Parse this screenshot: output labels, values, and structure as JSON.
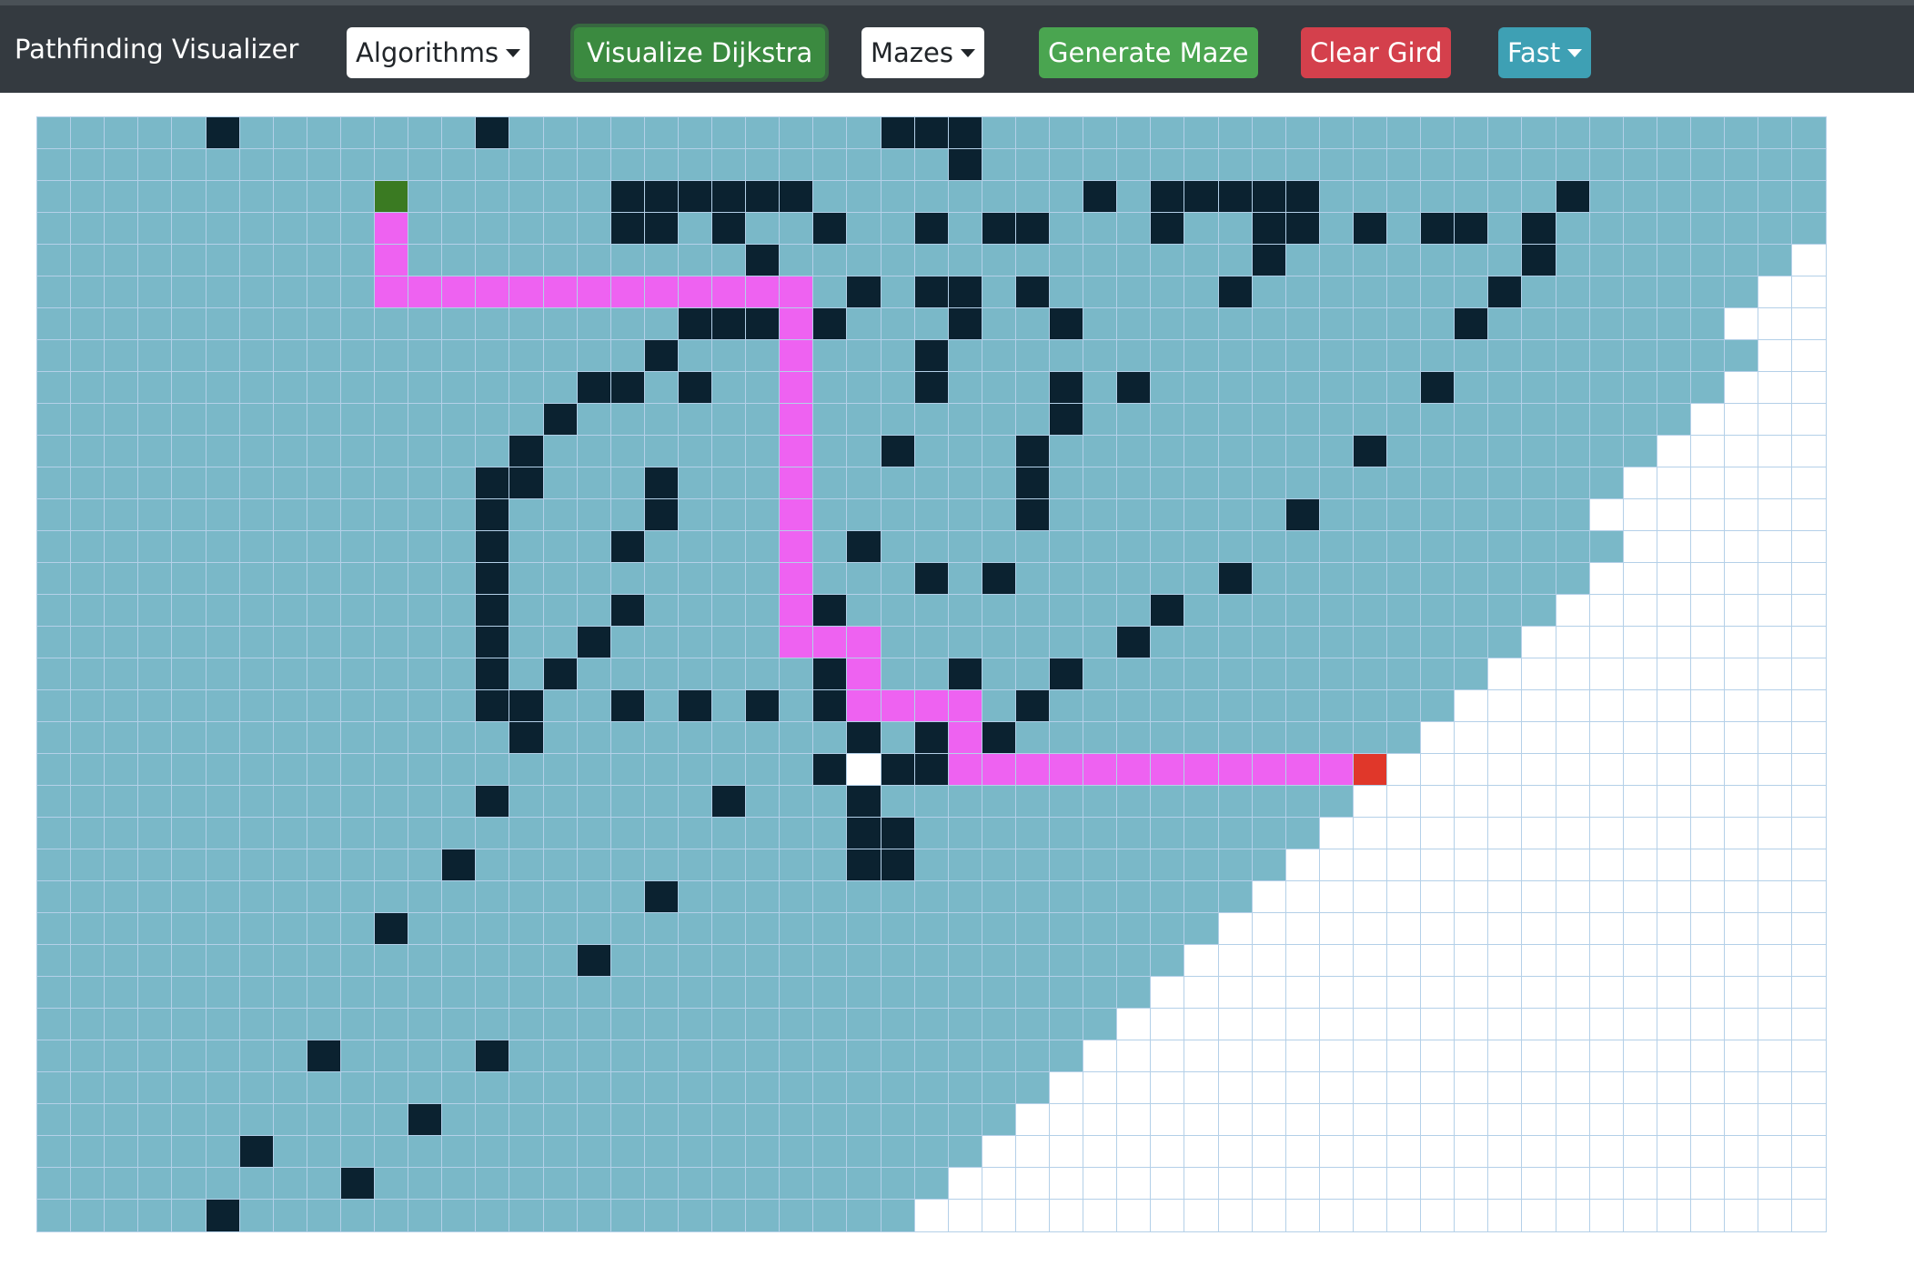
{
  "navbar": {
    "brand": "Pathfinding Visualizer",
    "algorithms_label": "Algorithms",
    "visualize_label": "Visualize Dijkstra",
    "mazes_label": "Mazes",
    "generate_maze_label": "Generate Maze",
    "clear_grid_label": "Clear Gird",
    "speed_label": "Fast"
  },
  "colors": {
    "visited": "#7ab8c8",
    "unvisited": "#ffffff",
    "wall": "#0b2230",
    "path": "#ee62f1",
    "start": "#3a7a22",
    "end": "#e0372a",
    "cell_border": "#b4d0e8"
  },
  "grid": {
    "rows": 35,
    "cols": 53,
    "start": [
      2,
      10
    ],
    "end": [
      20,
      39
    ],
    "visited_until_col": [
      52,
      52,
      52,
      52,
      51,
      50,
      49,
      50,
      49,
      48,
      47,
      46,
      45,
      46,
      45,
      44,
      43,
      42,
      41,
      40,
      39,
      38,
      37,
      36,
      35,
      34,
      33,
      32,
      31,
      30,
      29,
      28,
      27,
      26,
      25
    ],
    "walls": [
      [
        0,
        5
      ],
      [
        0,
        13
      ],
      [
        0,
        25
      ],
      [
        0,
        26
      ],
      [
        0,
        27
      ],
      [
        1,
        27
      ],
      [
        2,
        17
      ],
      [
        2,
        18
      ],
      [
        2,
        19
      ],
      [
        2,
        20
      ],
      [
        2,
        21
      ],
      [
        2,
        22
      ],
      [
        2,
        31
      ],
      [
        2,
        33
      ],
      [
        2,
        34
      ],
      [
        2,
        35
      ],
      [
        2,
        36
      ],
      [
        2,
        37
      ],
      [
        2,
        45
      ],
      [
        3,
        17
      ],
      [
        3,
        18
      ],
      [
        3,
        20
      ],
      [
        3,
        23
      ],
      [
        3,
        26
      ],
      [
        3,
        28
      ],
      [
        3,
        29
      ],
      [
        3,
        33
      ],
      [
        3,
        36
      ],
      [
        3,
        37
      ],
      [
        3,
        39
      ],
      [
        3,
        41
      ],
      [
        3,
        42
      ],
      [
        3,
        44
      ],
      [
        4,
        21
      ],
      [
        4,
        36
      ],
      [
        4,
        44
      ],
      [
        5,
        24
      ],
      [
        5,
        26
      ],
      [
        5,
        27
      ],
      [
        5,
        29
      ],
      [
        5,
        35
      ],
      [
        5,
        43
      ],
      [
        6,
        19
      ],
      [
        6,
        20
      ],
      [
        6,
        21
      ],
      [
        6,
        23
      ],
      [
        6,
        27
      ],
      [
        6,
        30
      ],
      [
        6,
        42
      ],
      [
        7,
        18
      ],
      [
        7,
        26
      ],
      [
        8,
        16
      ],
      [
        8,
        17
      ],
      [
        8,
        19
      ],
      [
        8,
        26
      ],
      [
        8,
        30
      ],
      [
        8,
        32
      ],
      [
        8,
        41
      ],
      [
        9,
        15
      ],
      [
        9,
        30
      ],
      [
        10,
        14
      ],
      [
        10,
        25
      ],
      [
        10,
        29
      ],
      [
        10,
        39
      ],
      [
        11,
        13
      ],
      [
        11,
        14
      ],
      [
        11,
        18
      ],
      [
        11,
        29
      ],
      [
        12,
        13
      ],
      [
        12,
        18
      ],
      [
        12,
        29
      ],
      [
        12,
        37
      ],
      [
        13,
        13
      ],
      [
        13,
        17
      ],
      [
        13,
        24
      ],
      [
        14,
        13
      ],
      [
        14,
        26
      ],
      [
        14,
        28
      ],
      [
        14,
        35
      ],
      [
        15,
        13
      ],
      [
        15,
        17
      ],
      [
        15,
        23
      ],
      [
        15,
        33
      ],
      [
        16,
        13
      ],
      [
        16,
        16
      ],
      [
        16,
        32
      ],
      [
        17,
        13
      ],
      [
        17,
        15
      ],
      [
        17,
        23
      ],
      [
        17,
        27
      ],
      [
        17,
        30
      ],
      [
        18,
        13
      ],
      [
        18,
        14
      ],
      [
        18,
        17
      ],
      [
        18,
        19
      ],
      [
        18,
        21
      ],
      [
        18,
        23
      ],
      [
        18,
        29
      ],
      [
        19,
        14
      ],
      [
        19,
        24
      ],
      [
        19,
        26
      ],
      [
        19,
        28
      ],
      [
        20,
        23
      ],
      [
        20,
        25
      ],
      [
        20,
        26
      ],
      [
        21,
        13
      ],
      [
        21,
        20
      ],
      [
        21,
        24
      ],
      [
        22,
        24
      ],
      [
        22,
        25
      ],
      [
        23,
        12
      ],
      [
        23,
        24
      ],
      [
        23,
        25
      ],
      [
        24,
        18
      ],
      [
        25,
        10
      ],
      [
        26,
        16
      ],
      [
        29,
        8
      ],
      [
        29,
        13
      ],
      [
        31,
        11
      ],
      [
        32,
        6
      ],
      [
        33,
        9
      ],
      [
        34,
        5
      ]
    ],
    "extra_unvisited": [
      [
        20,
        24
      ]
    ],
    "path": [
      [
        3,
        10
      ],
      [
        4,
        10
      ],
      [
        5,
        10
      ],
      [
        5,
        11
      ],
      [
        5,
        12
      ],
      [
        5,
        13
      ],
      [
        5,
        14
      ],
      [
        5,
        15
      ],
      [
        5,
        16
      ],
      [
        5,
        17
      ],
      [
        5,
        18
      ],
      [
        5,
        19
      ],
      [
        5,
        20
      ],
      [
        5,
        21
      ],
      [
        5,
        22
      ],
      [
        6,
        22
      ],
      [
        7,
        22
      ],
      [
        8,
        22
      ],
      [
        9,
        22
      ],
      [
        10,
        22
      ],
      [
        11,
        22
      ],
      [
        12,
        22
      ],
      [
        13,
        22
      ],
      [
        14,
        22
      ],
      [
        15,
        22
      ],
      [
        16,
        22
      ],
      [
        16,
        23
      ],
      [
        16,
        24
      ],
      [
        17,
        24
      ],
      [
        18,
        24
      ],
      [
        18,
        25
      ],
      [
        18,
        26
      ],
      [
        18,
        27
      ],
      [
        19,
        27
      ],
      [
        20,
        27
      ],
      [
        20,
        28
      ],
      [
        20,
        29
      ],
      [
        20,
        30
      ],
      [
        20,
        31
      ],
      [
        20,
        32
      ],
      [
        20,
        33
      ],
      [
        20,
        34
      ],
      [
        20,
        35
      ],
      [
        20,
        36
      ],
      [
        20,
        37
      ],
      [
        20,
        38
      ]
    ]
  }
}
